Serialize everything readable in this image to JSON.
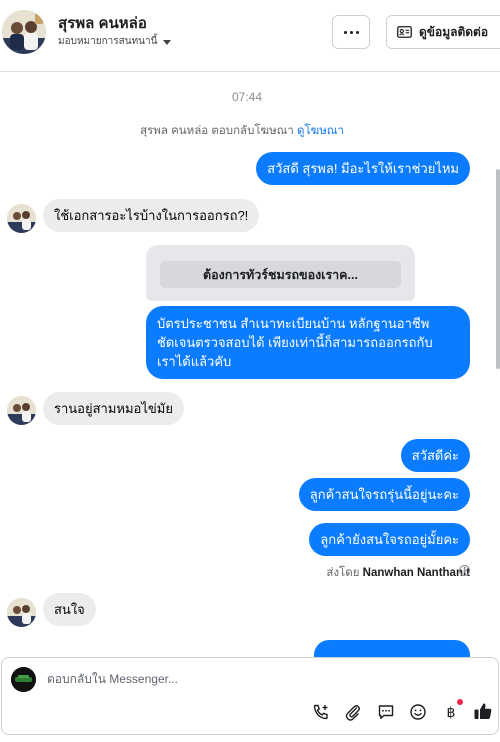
{
  "header": {
    "contact_name": "สุรพล คนหล่อ",
    "assign_label": "มอบหมายการสนทนานี้",
    "contact_info_button": "ดูข้อมูลติดต่อ"
  },
  "conversation": {
    "timestamp": "07:44",
    "ad_reply_text": "สุรพล คนหล่อ ตอบกลับโฆษณา",
    "ad_link": "ดูโฆษณา",
    "messages": [
      {
        "dir": "out",
        "text": "สวัสดี สุรพล! มีอะไรให้เราช่วยไหม"
      },
      {
        "dir": "in",
        "text": "ใช้เอกสารอะไรบ้างในการออกรถ?!"
      },
      {
        "dir": "card",
        "text": "ต้องการทัวร์ชมรถของเราค..."
      },
      {
        "dir": "out",
        "lines": [
          "บัตรประชาชน สำเนาทะเบียนบ้าน หลักฐานอาชีพ",
          "ชัดเจนตรวจสอบได้ เพียงเท่านี้ก็สามารถออกรถกับ",
          "เราได้แล้วคับ"
        ]
      },
      {
        "dir": "in",
        "text": "รานอยู่สามหมอไข่มัย"
      },
      {
        "dir": "out",
        "text": "สวัสดีค่ะ"
      },
      {
        "dir": "out",
        "text": "ลูกค้าสนใจรถรุ่นนี้อยู่นะคะ"
      },
      {
        "dir": "out",
        "text": "ลูกค้ายังสนใจรถอยู่มั้ยคะ"
      },
      {
        "dir": "in",
        "text": "สนใจ"
      }
    ],
    "sent_by_prefix": "ส่งโดย",
    "sent_by_name": "Nanwhan Nanthanit"
  },
  "composer": {
    "placeholder": "ตอบกลับใน Messenger...",
    "tools": [
      "add-call-icon",
      "attach-icon",
      "saved-reply-icon",
      "emoji-icon",
      "baht-payment-icon",
      "like-icon"
    ]
  },
  "colors": {
    "outgoing_bubble": "#0b7cff",
    "incoming_bubble": "#ececec",
    "link": "#1877f2",
    "notification_dot": "#f02849"
  }
}
